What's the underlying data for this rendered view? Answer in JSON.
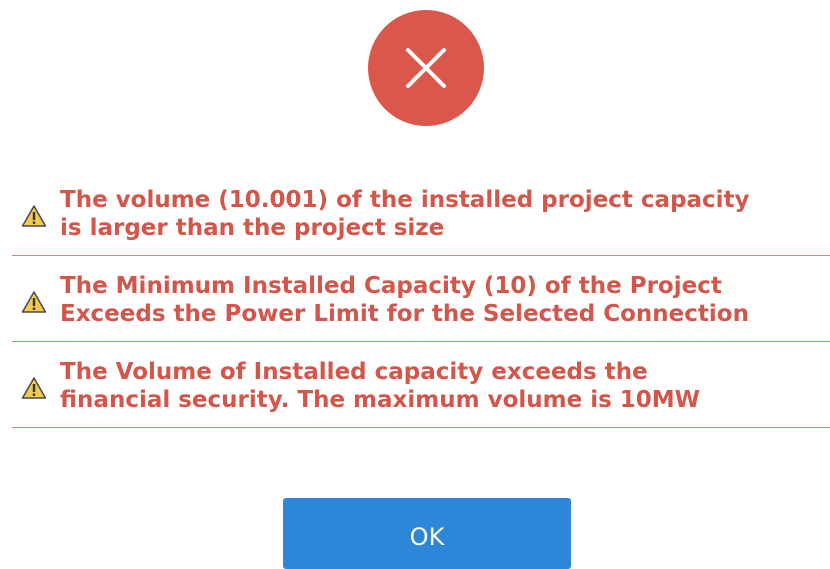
{
  "dialog": {
    "icon": "error-x-icon",
    "colors": {
      "error_circle": "#d9574b",
      "message_text": "#d4554a",
      "divider": "#e77b70",
      "warning_icon_fill": "#f2c94c",
      "button": "#2d86d8"
    },
    "messages": [
      {
        "icon": "warning-icon",
        "line1": "The volume (10.001) of the installed project capacity",
        "line2": "is larger than the project size"
      },
      {
        "icon": "warning-icon",
        "line1": "The Minimum Installed Capacity (10) of the Project",
        "line2": "Exceeds the Power Limit for the Selected Connection"
      },
      {
        "icon": "warning-icon",
        "line1": "The Volume of Installed capacity exceeds the",
        "line2": "financial security. The maximum volume is 10MW"
      }
    ],
    "ok_label": "OK"
  }
}
